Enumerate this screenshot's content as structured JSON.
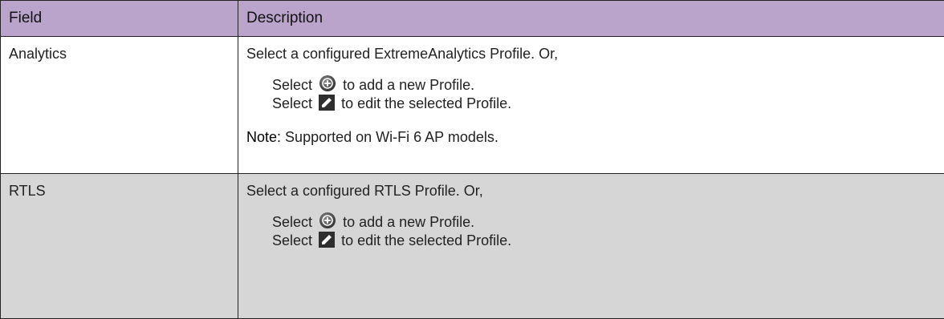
{
  "table": {
    "headers": {
      "field": "Field",
      "description": "Description"
    },
    "rows": [
      {
        "field": "Analytics",
        "description": "Select a configured ExtremeAnalytics Profile. Or,",
        "add_prefix": "Select",
        "add_suffix": "to add a new Profile.",
        "edit_prefix": "Select",
        "edit_suffix": "to edit the selected Profile.",
        "note_label": "Note:",
        "note_text": "Supported on Wi-Fi 6 AP models."
      },
      {
        "field": "RTLS",
        "description": "Select a configured RTLS Profile. Or,",
        "add_prefix": "Select",
        "add_suffix": "to add a new Profile.",
        "edit_prefix": "Select",
        "edit_suffix": "to edit the selected Profile."
      }
    ]
  },
  "icons": {
    "add": "add-circle-icon",
    "edit": "edit-pencil-icon"
  },
  "colors": {
    "header_background": "#baa4cc",
    "row_alternate_background": "#d6d6d6",
    "border": "#222222"
  }
}
